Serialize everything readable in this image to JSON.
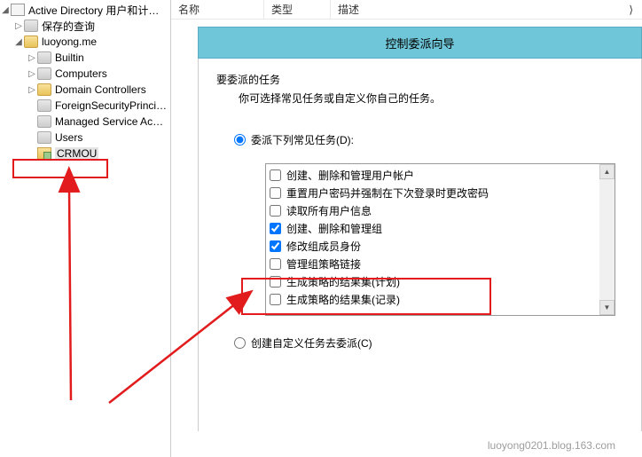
{
  "sidebar": {
    "root": "Active Directory 用户和计算机",
    "items": [
      {
        "label": "保存的查询",
        "expand": "▷",
        "icon": "folder-grey"
      },
      {
        "label": "luoyong.me",
        "expand": "◢",
        "icon": "folder"
      }
    ],
    "children": [
      {
        "label": "Builtin",
        "expand": "▷",
        "icon": "folder-grey"
      },
      {
        "label": "Computers",
        "expand": "▷",
        "icon": "folder-grey"
      },
      {
        "label": "Domain Controllers",
        "expand": "▷",
        "icon": "folder"
      },
      {
        "label": "ForeignSecurityPrincipals",
        "expand": "",
        "icon": "folder-grey"
      },
      {
        "label": "Managed Service Accounts",
        "expand": "",
        "icon": "folder-grey"
      },
      {
        "label": "Users",
        "expand": "",
        "icon": "folder-grey"
      },
      {
        "label": "CRMOU",
        "expand": "",
        "icon": "ou",
        "selected": true
      }
    ]
  },
  "columns": {
    "name": "名称",
    "type": "类型",
    "desc": "描述",
    "chev": "⟩"
  },
  "wizard": {
    "title": "控制委派向导",
    "section_title": "要委派的任务",
    "section_desc": "你可选择常见任务或自定义你自己的任务。",
    "radio1": "委派下列常见任务(D):",
    "radio2": "创建自定义任务去委派(C)",
    "tasks": [
      {
        "label": "创建、删除和管理用户帐户",
        "checked": false
      },
      {
        "label": "重置用户密码并强制在下次登录时更改密码",
        "checked": false
      },
      {
        "label": "读取所有用户信息",
        "checked": false
      },
      {
        "label": "创建、删除和管理组",
        "checked": true
      },
      {
        "label": "修改组成员身份",
        "checked": true
      },
      {
        "label": "管理组策略链接",
        "checked": false
      },
      {
        "label": "生成策略的结果集(计划)",
        "checked": false
      },
      {
        "label": "生成策略的结果集(记录)",
        "checked": false
      }
    ]
  },
  "watermark": "luoyong0201.blog.163.com"
}
